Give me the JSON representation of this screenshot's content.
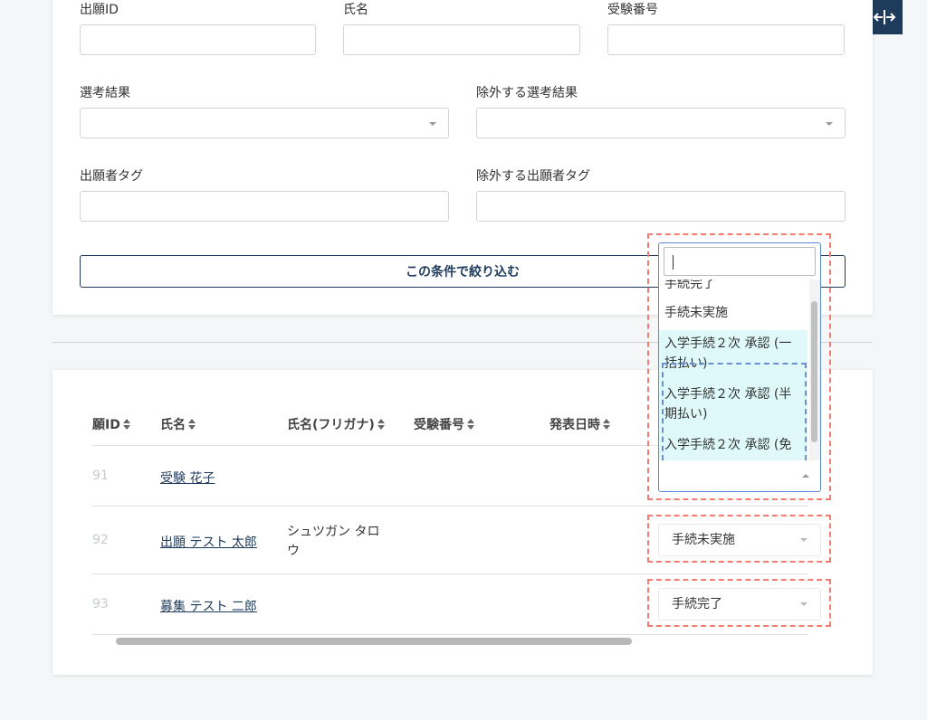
{
  "filter": {
    "application_id_label": "出願ID",
    "name_label": "氏名",
    "exam_number_label": "受験番号",
    "selection_result_label": "選考結果",
    "exclude_selection_result_label": "除外する選考結果",
    "applicant_tag_label": "出願者タグ",
    "exclude_applicant_tag_label": "除外する出願者タグ",
    "submit_label": "この条件で絞り込む"
  },
  "table": {
    "headers": [
      "願ID",
      "氏名",
      "氏名(フリガナ)",
      "受験番号",
      "発表日時"
    ],
    "rows": [
      {
        "id": "91",
        "name": "受験 花子",
        "kana": "",
        "status": ""
      },
      {
        "id": "92",
        "name": "出願 テスト 太郎",
        "kana": "シュツガン タロウ",
        "status": "手続未実施"
      },
      {
        "id": "93",
        "name": "募集 テスト 二郎",
        "kana": "",
        "status": "手続完了"
      }
    ]
  },
  "dropdown": {
    "search_value": "",
    "options": [
      "手続完了",
      "手続未実施",
      "入学手続２次 承認 (一括払い)",
      "入学手続２次 承認 (半期払い)",
      "入学手続２次 承認 (免"
    ]
  },
  "icons": {
    "collapse": "collapse-horizontal-icon",
    "sort": "sort-icon"
  },
  "colors": {
    "primary": "#1f3b5c",
    "highlight": "#dff9fb",
    "annotation_red": "#f47c6e",
    "annotation_blue": "#6b8fd6"
  }
}
